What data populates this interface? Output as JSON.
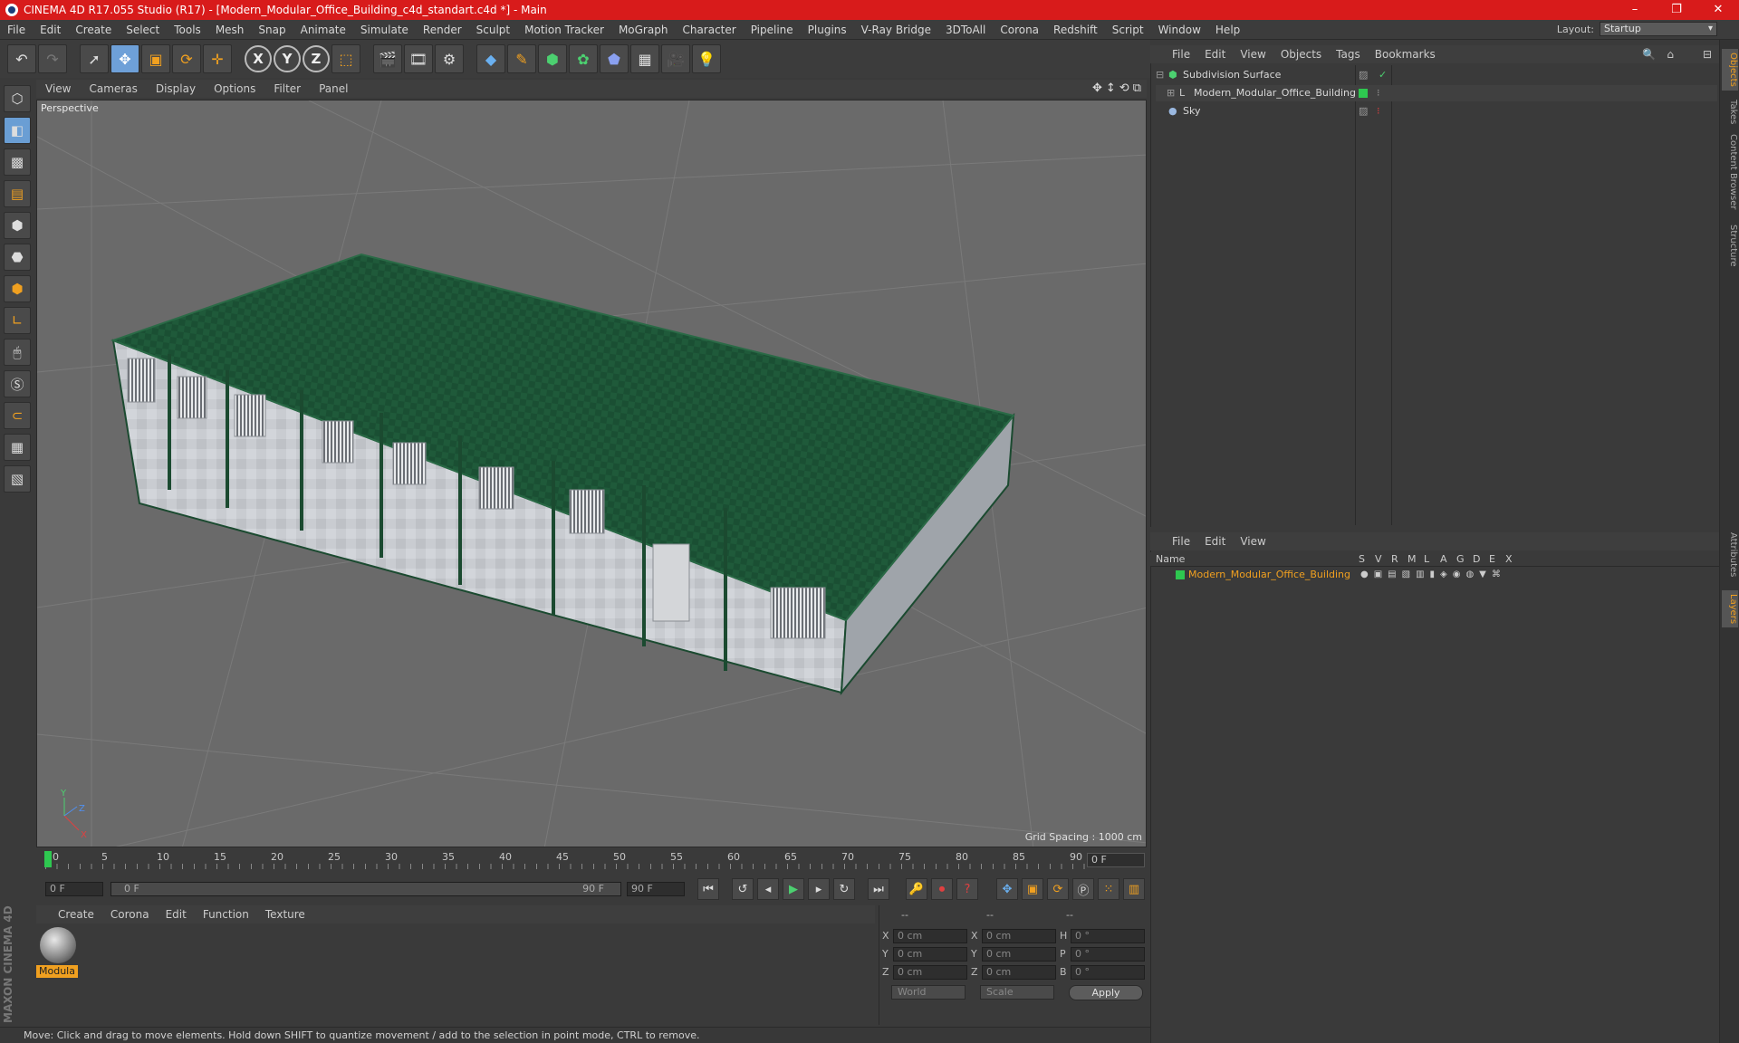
{
  "window": {
    "title": "CINEMA 4D R17.055 Studio (R17) - [Modern_Modular_Office_Building_c4d_standart.c4d *] - Main",
    "minimize": "–",
    "maximize": "❐",
    "close": "✕"
  },
  "menu": [
    "File",
    "Edit",
    "Create",
    "Select",
    "Tools",
    "Mesh",
    "Snap",
    "Animate",
    "Simulate",
    "Render",
    "Sculpt",
    "Motion Tracker",
    "MoGraph",
    "Character",
    "Pipeline",
    "Plugins",
    "V-Ray Bridge",
    "3DToAll",
    "Corona",
    "Redshift",
    "Script",
    "Window",
    "Help"
  ],
  "layout": {
    "label": "Layout:",
    "value": "Startup"
  },
  "viewport": {
    "menu": [
      "View",
      "Cameras",
      "Display",
      "Options",
      "Filter",
      "Panel"
    ],
    "label": "Perspective",
    "grid_spacing": "Grid Spacing : 1000 cm"
  },
  "timeline": {
    "ticks": [
      "0",
      "5",
      "10",
      "15",
      "20",
      "25",
      "30",
      "35",
      "40",
      "45",
      "50",
      "55",
      "60",
      "65",
      "70",
      "75",
      "80",
      "85",
      "90"
    ],
    "current_frame": "0 F",
    "start_frame": "0 F",
    "range_start": "0 F",
    "range_end": "90 F",
    "end_frame": "90 F"
  },
  "material_manager": {
    "menu": [
      "Create",
      "Corona",
      "Edit",
      "Function",
      "Texture"
    ],
    "material_name": "Modula"
  },
  "coordinates": {
    "header": [
      "--",
      "--",
      "--"
    ],
    "rows": [
      {
        "axis": "X",
        "pos": "0 cm",
        "axis2": "X",
        "size": "0 cm",
        "rot_label": "H",
        "rot": "0 °"
      },
      {
        "axis": "Y",
        "pos": "0 cm",
        "axis2": "Y",
        "size": "0 cm",
        "rot_label": "P",
        "rot": "0 °"
      },
      {
        "axis": "Z",
        "pos": "0 cm",
        "axis2": "Z",
        "size": "0 cm",
        "rot_label": "B",
        "rot": "0 °"
      }
    ],
    "mode": "World",
    "scale": "Scale",
    "apply": "Apply"
  },
  "status": "Move: Click and drag to move elements. Hold down SHIFT to quantize movement / add to the selection in point mode, CTRL to remove.",
  "object_manager": {
    "menu": [
      "File",
      "Edit",
      "View",
      "Objects",
      "Tags",
      "Bookmarks"
    ],
    "objects": [
      "Subdivision Surface",
      "Modern_Modular_Office_Building",
      "Sky"
    ]
  },
  "layer_manager": {
    "menu": [
      "File",
      "Edit",
      "View"
    ],
    "columns": [
      "Name",
      "S",
      "V",
      "R",
      "M",
      "L",
      "A",
      "G",
      "D",
      "E",
      "X"
    ],
    "layer": "Modern_Modular_Office_Building"
  },
  "side_tabs": [
    "Objects",
    "Takes",
    "Content Browser",
    "Structure",
    "Attributes",
    "Layers"
  ],
  "brand": "MAXON CINEMA 4D",
  "colors": {
    "title_bar": "#d81b1b",
    "accent": "#f0a020",
    "roof": "#1f5a3a",
    "selection": "#6ea0d8"
  }
}
